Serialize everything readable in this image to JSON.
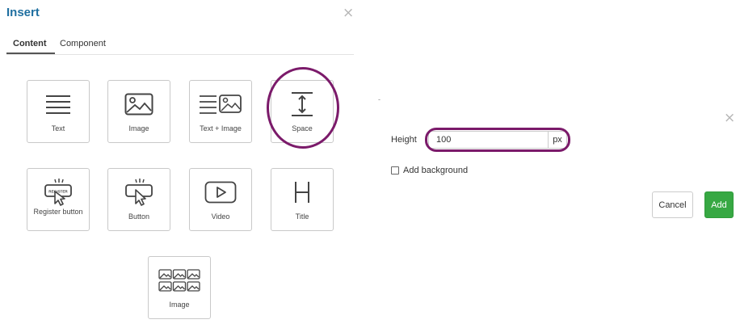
{
  "dialog": {
    "title": "Insert",
    "close_glyph": "×",
    "tabs": [
      {
        "label": "Content",
        "active": true
      },
      {
        "label": "Component",
        "active": false
      }
    ],
    "tiles": [
      {
        "label": "Text",
        "icon": "text-lines-icon"
      },
      {
        "label": "Image",
        "icon": "image-icon"
      },
      {
        "label": "Text + Image",
        "icon": "text-image-icon"
      },
      {
        "label": "Space",
        "icon": "vertical-space-icon",
        "highlighted": true
      },
      {
        "label": "Register button",
        "icon": "register-button-icon"
      },
      {
        "label": "Button",
        "icon": "button-click-icon"
      },
      {
        "label": "Video",
        "icon": "play-icon"
      },
      {
        "label": "Title",
        "icon": "heading-h-icon"
      },
      {
        "label": "Image",
        "icon": "image-gallery-icon"
      }
    ],
    "register_icon_text": "REGISTER"
  },
  "space_settings": {
    "dot": "-",
    "close_glyph": "×",
    "height_label": "Height",
    "height_value": "100",
    "unit": "px",
    "background_checked": false,
    "background_label": "Add background",
    "cancel_label": "Cancel",
    "add_label": "Add"
  },
  "colors": {
    "title": "#1f6fa0",
    "highlight": "#7b1a6a",
    "add_button": "#37a843"
  }
}
